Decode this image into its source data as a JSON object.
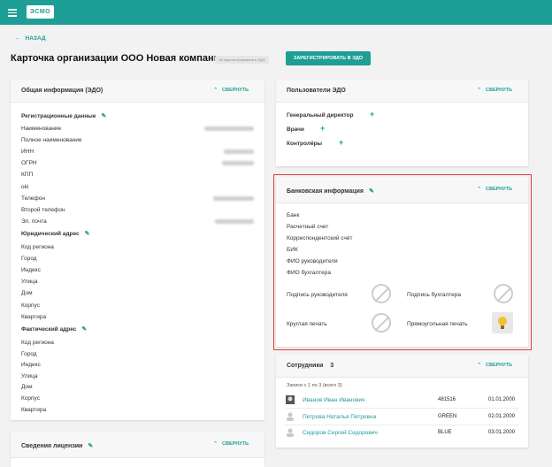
{
  "app": {
    "logo": "ЭСМО"
  },
  "nav": {
    "back": "НАЗАД"
  },
  "page": {
    "title": "Карточка организации ООО Новая компания",
    "badge": "Не зарегистрирована в ЭДО",
    "register_button": "ЗАРЕГИСТРИРОВАТЬ В ЭДО"
  },
  "collapse_label": "СВЕРНУТЬ",
  "general": {
    "title": "Общая информация (ЭДО)",
    "reg_section": "Регистрационные данные",
    "reg_fields": [
      "Наименование",
      "Полное наименование",
      "ИНН",
      "ОГРН",
      "КПП",
      "oki",
      "Телефон",
      "Второй телефон",
      "Эл. почта"
    ],
    "legal_section": "Юридический адрес",
    "legal_fields": [
      "Код региона",
      "Город",
      "Индекс",
      "Улица",
      "Дом",
      "Корпус",
      "Квартира"
    ],
    "actual_section": "Фактический адрес",
    "actual_fields": [
      "Код региона",
      "Город",
      "Индекс",
      "Улица",
      "Дом",
      "Корпус",
      "Квартира"
    ]
  },
  "license": {
    "title": "Сведения лицензии"
  },
  "users": {
    "title": "Пользователи ЭДО",
    "roles": [
      "Генеральный директор",
      "Врачи",
      "Контролёры"
    ]
  },
  "bank": {
    "title": "Банковская информация",
    "fields": [
      "Банк",
      "Расчетный счет",
      "Корреспондентский счёт",
      "БИК",
      "ФИО руководителя",
      "ФИО бухгалтера"
    ],
    "sign_director": "Подпись руководителя",
    "sign_accountant": "Подпись бухгалтера",
    "round_seal": "Круглая печать",
    "rect_seal": "Прямоугольная печать"
  },
  "employees": {
    "title": "Сотрудники",
    "count": "3",
    "summary": "Записи с 1 по 3 (всего 3)",
    "rows": [
      {
        "name": "Иванов Иван Иванович",
        "code": "481516",
        "date": "01.01.2000"
      },
      {
        "name": "Петрова Наталья Петровна",
        "code": "GREEN",
        "date": "02.01.2000"
      },
      {
        "name": "Сидоров Сергей Сидорович",
        "code": "BLUE",
        "date": "03.01.2000"
      }
    ]
  },
  "colors": {
    "accent": "#1d9e96",
    "highlight": "#e23b3b"
  }
}
